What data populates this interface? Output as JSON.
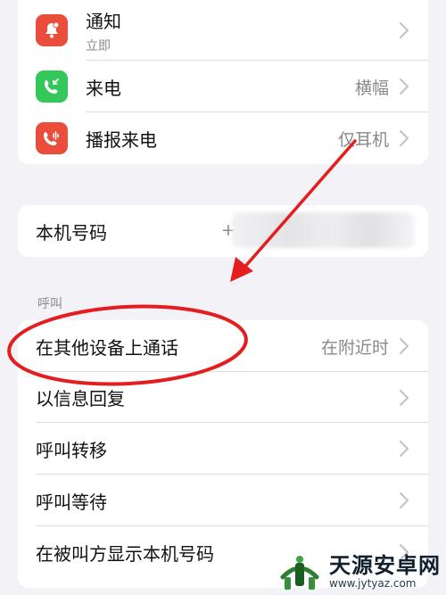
{
  "card_top": {
    "rows": [
      {
        "label": "通知",
        "sublabel": "立即",
        "icon": "bell-icon"
      },
      {
        "label": "来电",
        "value": "横幅",
        "icon": "incoming-call-icon"
      },
      {
        "label": "播报来电",
        "value": "仅耳机",
        "icon": "announce-call-icon"
      }
    ]
  },
  "my_number": {
    "label": "本机号码",
    "value_prefix": "+"
  },
  "calls_section": {
    "header": "呼叫",
    "rows": [
      {
        "label": "在其他设备上通话",
        "value": "在附近时"
      },
      {
        "label": "以信息回复"
      },
      {
        "label": "呼叫转移"
      },
      {
        "label": "呼叫等待"
      },
      {
        "label": "在被叫方显示本机号码"
      }
    ]
  },
  "watermark": {
    "title": "天源安卓网",
    "url": "www.jytyaz.com"
  },
  "colors": {
    "annotation": "#e41e1e",
    "background": "#f2f2f7",
    "icon_red": "#eb4d3d",
    "icon_green": "#34c759"
  }
}
